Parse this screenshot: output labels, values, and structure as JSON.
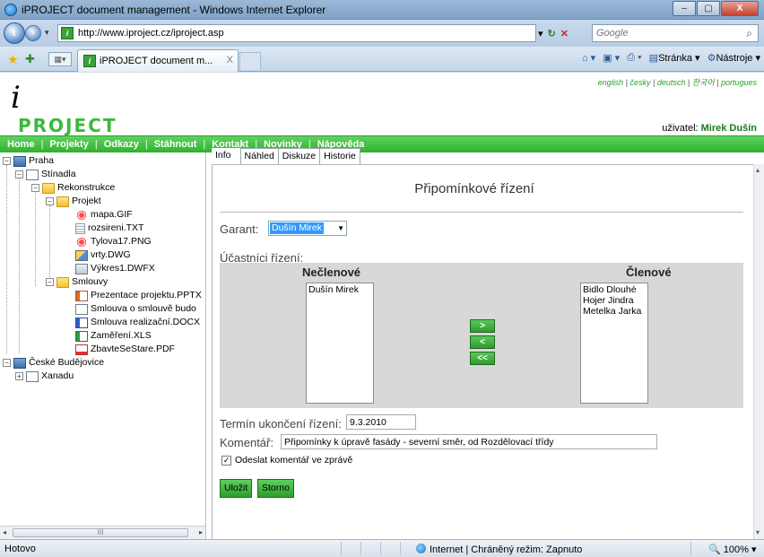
{
  "window": {
    "title": "iPROJECT document management - Windows Internet Explorer",
    "controls": [
      "–",
      "▢",
      "X"
    ]
  },
  "address_bar": {
    "url": "http://www.iproject.cz/iproject.asp",
    "search_placeholder": "Google"
  },
  "browser_tab": {
    "label": "iPROJECT document m...",
    "close": "X"
  },
  "command_bar": {
    "page": "Stránka",
    "tools": "Nástroje"
  },
  "site": {
    "logo_mark": "i",
    "logo_text": "PROJECT",
    "languages": [
      "english",
      "česky",
      "deutsch",
      "한국어",
      "portugues"
    ],
    "user_label": "uživatel:",
    "user_name": "Mirek Dušín",
    "nav": [
      "Home",
      "Projekty",
      "Odkazy",
      "Stáhnout",
      "Kontakt",
      "Novinky",
      "Nápověda"
    ]
  },
  "tree": [
    {
      "label": "Praha",
      "icon": "server-icon",
      "level": 0,
      "expander": "−"
    },
    {
      "label": "Stínadla",
      "icon": "project-icon",
      "level": 1,
      "expander": "−"
    },
    {
      "label": "Rekonstrukce",
      "icon": "folder-icon",
      "level": 2,
      "expander": "−"
    },
    {
      "label": "Projekt",
      "icon": "folder-icon",
      "level": 3,
      "expander": "−"
    },
    {
      "label": "mapa.GIF",
      "icon": "gif-file-icon",
      "level": 4
    },
    {
      "label": "rozsireni.TXT",
      "icon": "txt-file-icon",
      "level": 4
    },
    {
      "label": "Tylova17.PNG",
      "icon": "png-file-icon",
      "level": 4
    },
    {
      "label": "vrty.DWG",
      "icon": "dwg-file-icon",
      "level": 4
    },
    {
      "label": "Výkres1.DWFX",
      "icon": "dwfx-file-icon",
      "level": 4
    },
    {
      "label": "Smlouvy",
      "icon": "folder-icon",
      "level": 3,
      "expander": "−"
    },
    {
      "label": "Prezentace projektu.PPTX",
      "icon": "pptx-file-icon",
      "level": 4
    },
    {
      "label": "Smlouva o smlouvě budo",
      "icon": "document-icon",
      "level": 4
    },
    {
      "label": "Smlouva realizační.DOCX",
      "icon": "docx-file-icon",
      "level": 4
    },
    {
      "label": "Zaměření.XLS",
      "icon": "xls-file-icon",
      "level": 4
    },
    {
      "label": "ZbavteSeStare.PDF",
      "icon": "pdf-file-icon",
      "level": 4
    },
    {
      "label": "České Budějovice",
      "icon": "server-icon",
      "level": 0,
      "expander": "−"
    },
    {
      "label": "Xanadu",
      "icon": "project-icon",
      "level": 1,
      "expander": "+"
    }
  ],
  "tree_scrollbar": {
    "thumb": "III"
  },
  "content_tabs": [
    "Info",
    "Náhled",
    "Diskuze",
    "Historie"
  ],
  "form": {
    "title": "Připomínkové řízení",
    "garant_label": "Garant:",
    "garant_value": "Dušín Mirek",
    "participants_label": "Účastníci řízení:",
    "nonmembers_title": "Nečlenové",
    "members_title": "Členové",
    "nonmembers": [
      "Dušín Mirek"
    ],
    "members": [
      "Bidlo Dlouhé",
      "Hojer Jindra",
      "Metelka Jarka"
    ],
    "btn_add": ">",
    "btn_remove": "<",
    "btn_remove_all": "<<",
    "termin_label": "Termín ukončení řízení:",
    "termin_value": "9.3.2010",
    "comment_label": "Komentář:",
    "comment_value": "Připomínky k úpravě fasády - severní směr, od Rozdělovací třídy",
    "send_comment_label": "Odeslat komentář ve zprávě",
    "send_comment_checked": true,
    "save_label": "Uložit",
    "cancel_label": "Storno"
  },
  "status_bar": {
    "status": "Hotovo",
    "zone": "Internet | Chráněný režim: Zapnuto",
    "zoom": "100%"
  },
  "colors": {
    "nav_green": "#3cbf3c",
    "logo_green": "#3cb83c",
    "selection_blue": "#3399ff",
    "panel_gray": "#d8d8d8"
  }
}
